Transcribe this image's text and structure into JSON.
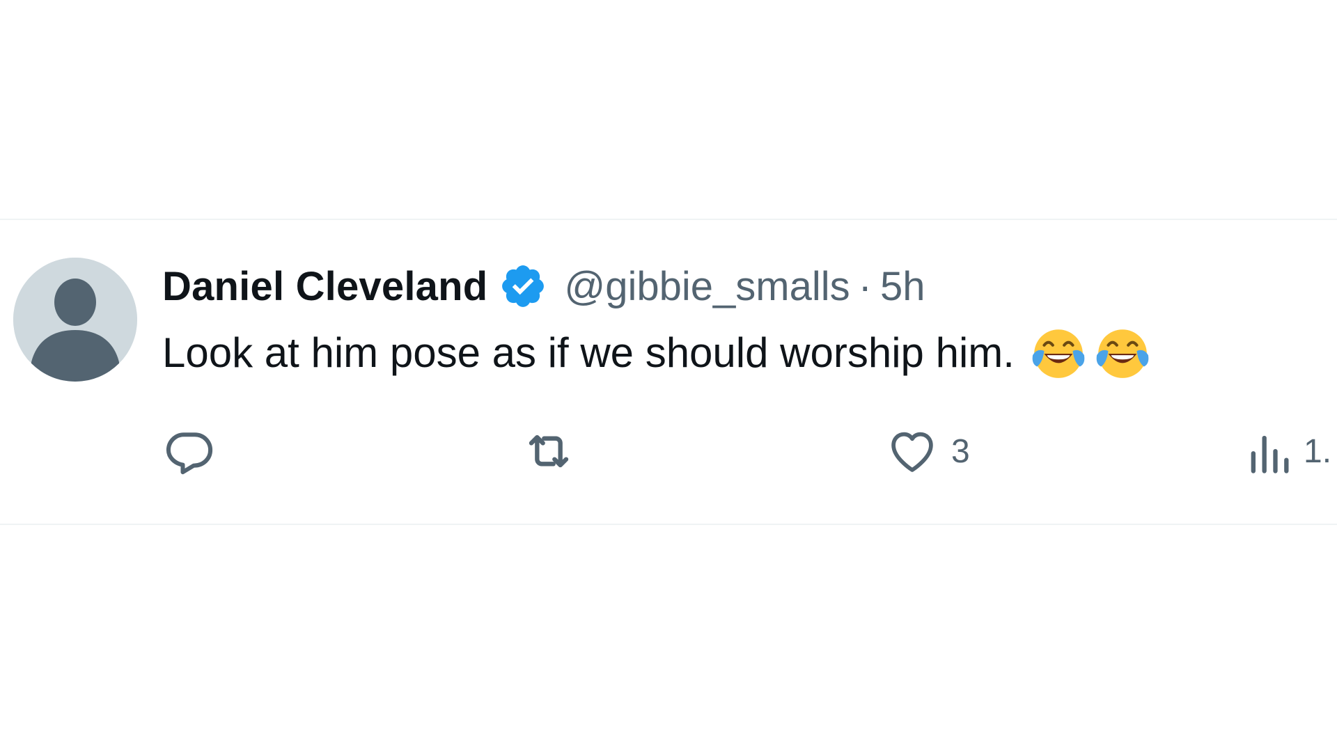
{
  "tweet": {
    "display_name": "Daniel Cleveland",
    "handle": "@gibbie_smalls",
    "separator": "·",
    "time": "5h",
    "text": "Look at him pose as if we should worship him.",
    "emojis": [
      "face-with-tears-of-joy",
      "face-with-tears-of-joy"
    ],
    "verified_color": "#1d9bf0"
  },
  "actions": {
    "reply_icon": "reply-icon",
    "retweet_icon": "retweet-icon",
    "like_icon": "heart-icon",
    "like_count": "3",
    "views_icon": "analytics-icon",
    "views_count": "1."
  },
  "colors": {
    "text_primary": "#0f1419",
    "text_secondary": "#536471",
    "divider": "#eff3f4",
    "avatar_bg": "#cfd9de",
    "avatar_fg": "#536471"
  }
}
